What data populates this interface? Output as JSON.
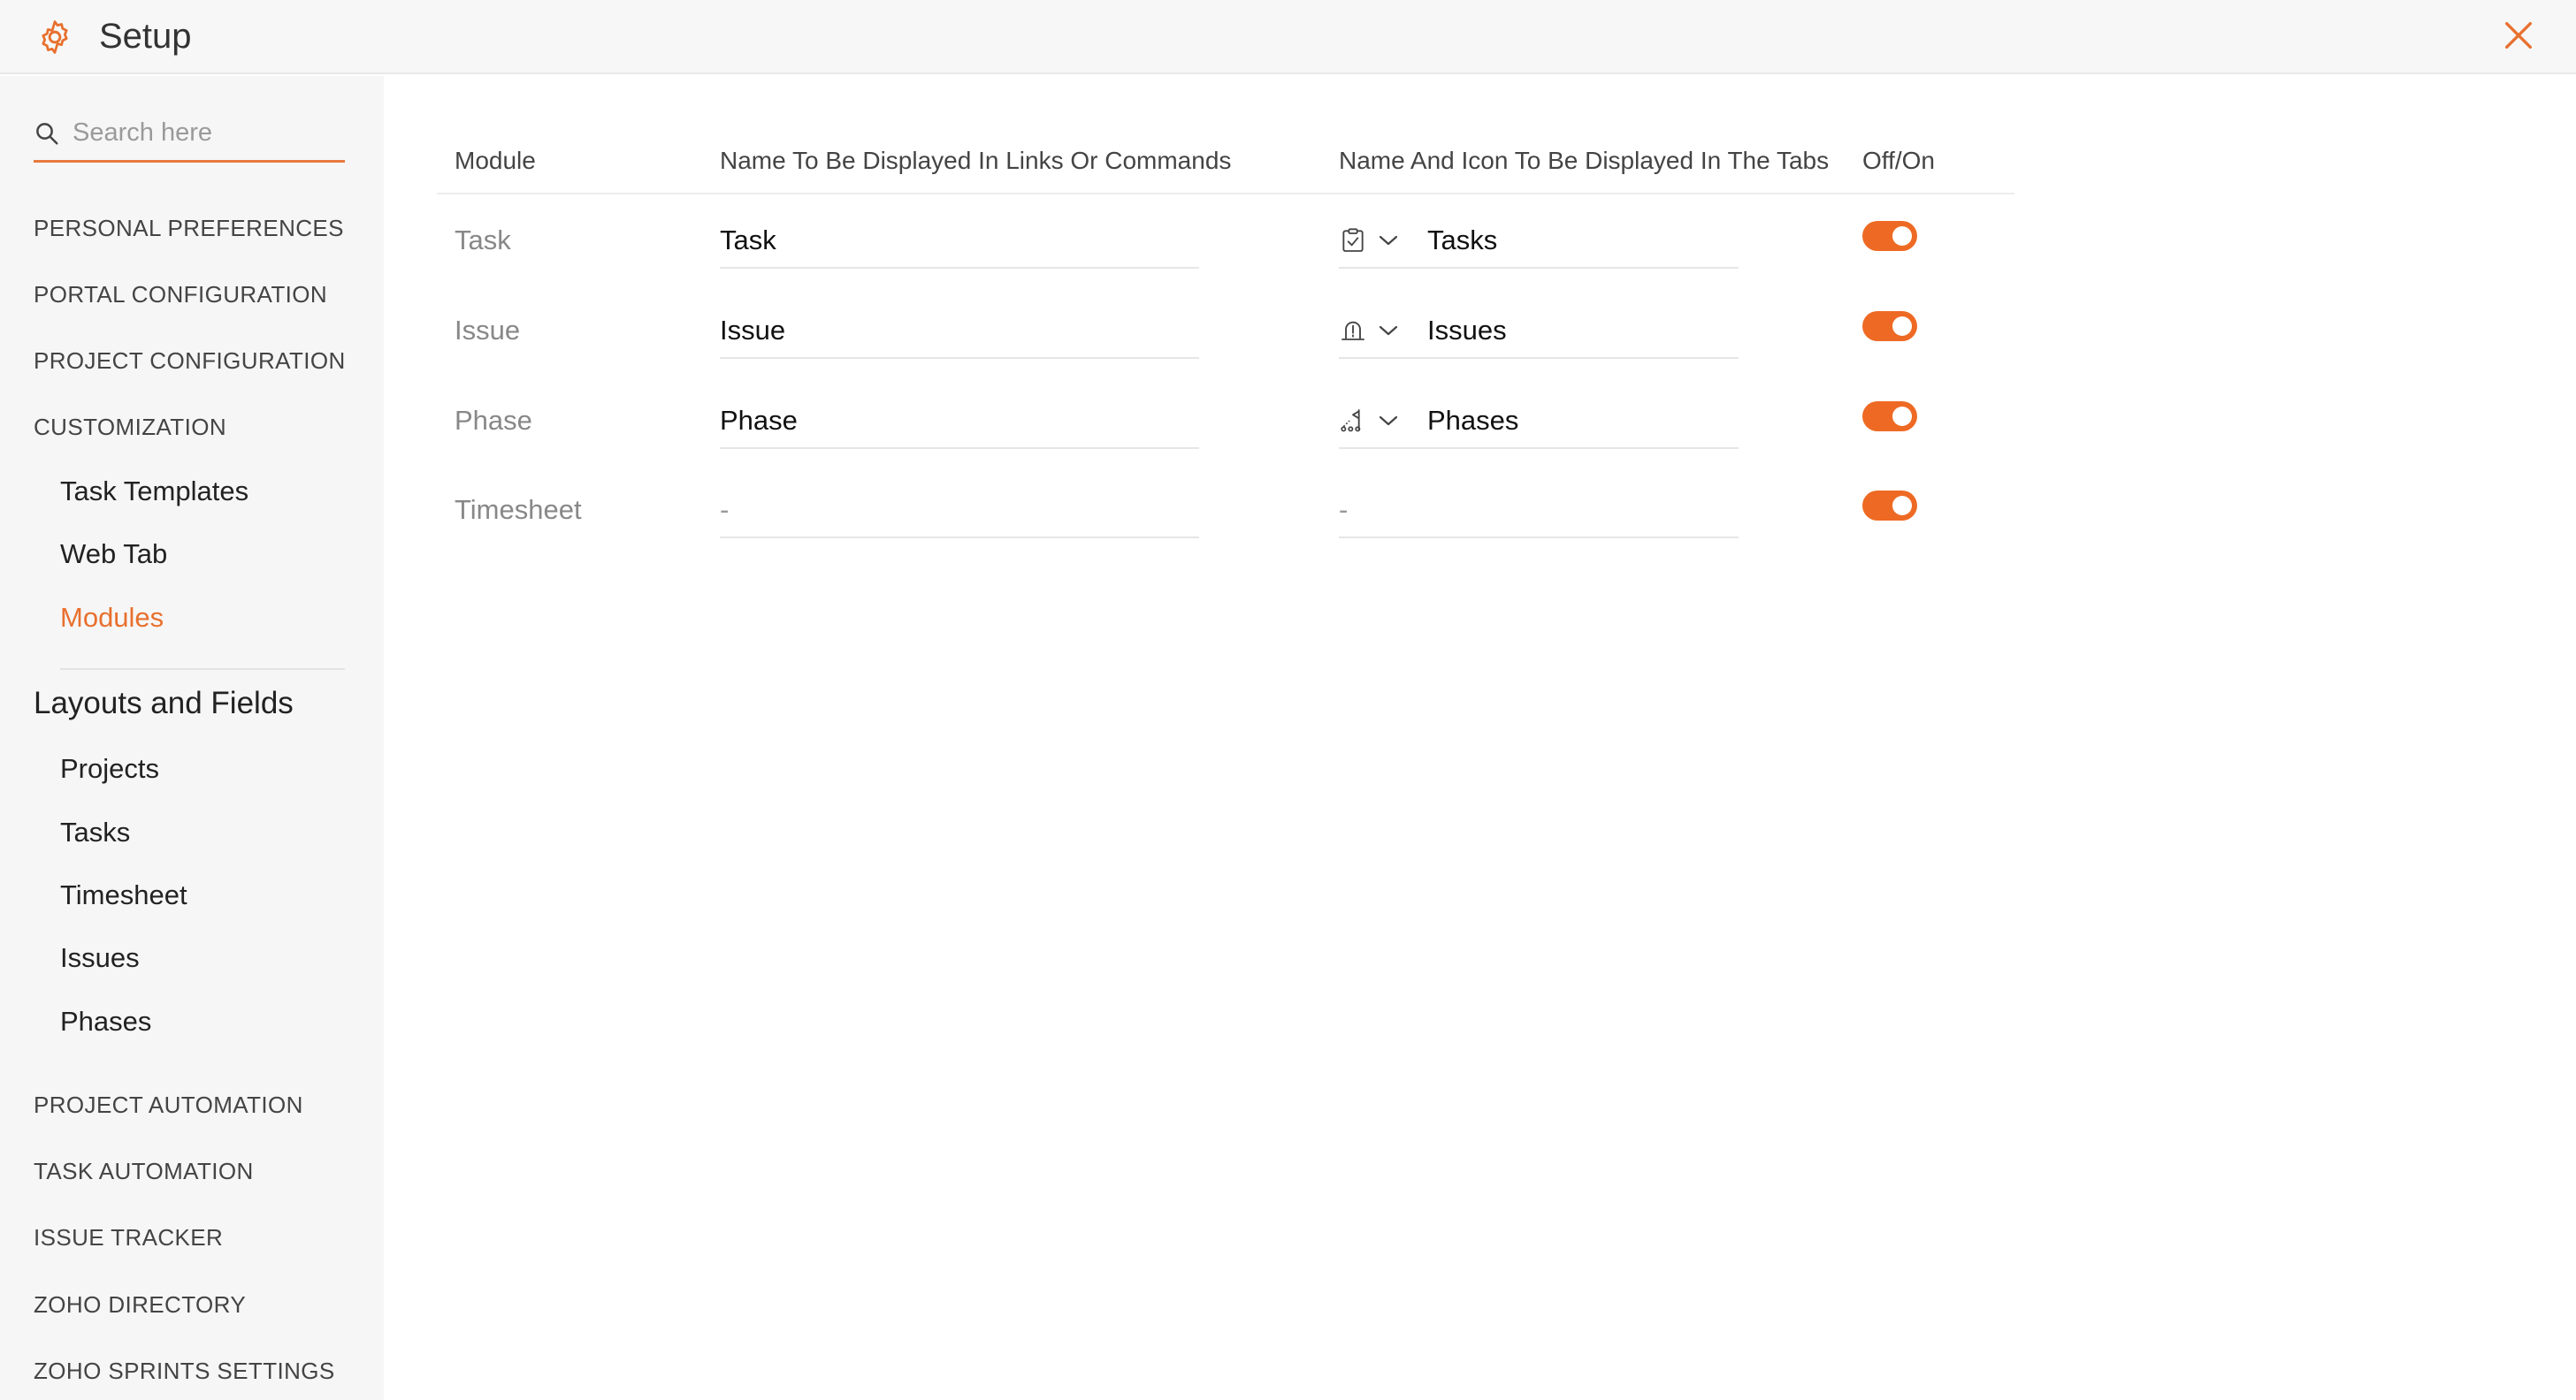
{
  "header": {
    "title": "Setup"
  },
  "search": {
    "placeholder": "Search here"
  },
  "sidebar": {
    "sections": {
      "personal_preferences": "PERSONAL PREFERENCES",
      "portal_configuration": "PORTAL CONFIGURATION",
      "project_configuration": "PROJECT CONFIGURATION",
      "customization": "CUSTOMIZATION",
      "project_automation": "PROJECT AUTOMATION",
      "task_automation": "TASK AUTOMATION",
      "issue_tracker": "ISSUE TRACKER",
      "zoho_directory": "ZOHO DIRECTORY",
      "zoho_sprints_settings": "ZOHO SPRINTS SETTINGS"
    },
    "customization_items": [
      "Task Templates",
      "Web Tab",
      "Modules"
    ],
    "layouts_title": "Layouts and Fields",
    "layouts_items": [
      "Projects",
      "Tasks",
      "Timesheet",
      "Issues",
      "Phases"
    ]
  },
  "table": {
    "headers": {
      "module": "Module",
      "name_links": "Name To Be Displayed In Links Or Commands",
      "name_tabs": "Name And Icon To Be Displayed In The Tabs",
      "off_on": "Off/On"
    },
    "rows": [
      {
        "module": "Task",
        "link_name": "Task",
        "tab_icon": "task-clipboard-icon",
        "tab_name": "Tasks",
        "enabled": true
      },
      {
        "module": "Issue",
        "link_name": "Issue",
        "tab_icon": "issue-bug-icon",
        "tab_name": "Issues",
        "enabled": true
      },
      {
        "module": "Phase",
        "link_name": "Phase",
        "tab_icon": "phase-flag-icon",
        "tab_name": "Phases",
        "enabled": true
      },
      {
        "module": "Timesheet",
        "link_name": "-",
        "tab_icon": "",
        "tab_name": "-",
        "enabled": true
      }
    ]
  },
  "colors": {
    "accent": "#e8702e",
    "toggle_on": "#ee6a24",
    "sidebar_bg": "#f6f6f6"
  }
}
